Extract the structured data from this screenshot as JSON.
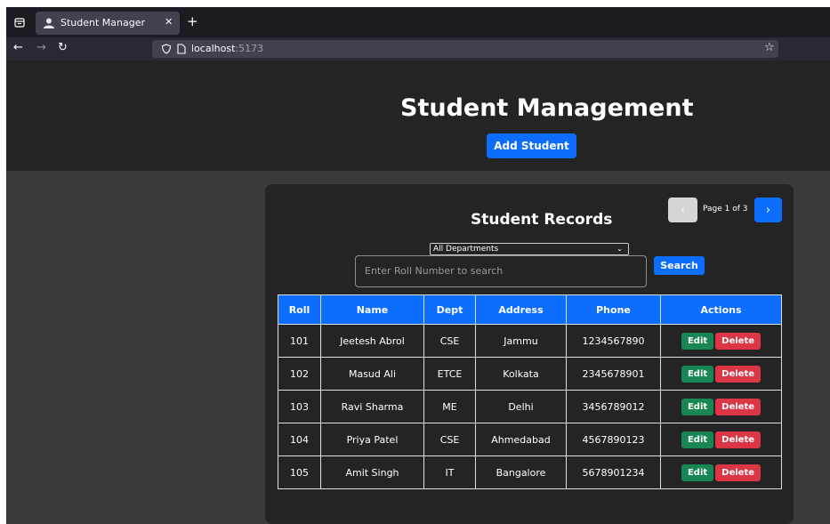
{
  "browser": {
    "tab_title": "Student Manager",
    "url_host": "localhost",
    "url_port": ":5173"
  },
  "header": {
    "title": "Student Management",
    "add_label": "Add Student"
  },
  "card": {
    "title": "Student Records",
    "pagination": {
      "prev": "‹",
      "next": "›",
      "info": "Page 1 of 3"
    },
    "department_select": "All Departments",
    "search_placeholder": "Enter Roll Number to search",
    "search_label": "Search"
  },
  "table": {
    "columns": [
      "Roll",
      "Name",
      "Dept",
      "Address",
      "Phone",
      "Actions"
    ],
    "rows": [
      [
        "101",
        "Jeetesh Abrol",
        "CSE",
        "Jammu",
        "1234567890"
      ],
      [
        "102",
        "Masud Ali",
        "ETCE",
        "Kolkata",
        "2345678901"
      ],
      [
        "103",
        "Ravi Sharma",
        "ME",
        "Delhi",
        "3456789012"
      ],
      [
        "104",
        "Priya Patel",
        "CSE",
        "Ahmedabad",
        "4567890123"
      ],
      [
        "105",
        "Amit Singh",
        "IT",
        "Bangalore",
        "5678901234"
      ]
    ],
    "edit_label": "Edit",
    "delete_label": "Delete"
  },
  "colors": {
    "primary": "#0d6efd",
    "success": "#198754",
    "danger": "#dc3545",
    "header_bg": "#242424",
    "page_bg": "#3a3a3a"
  }
}
